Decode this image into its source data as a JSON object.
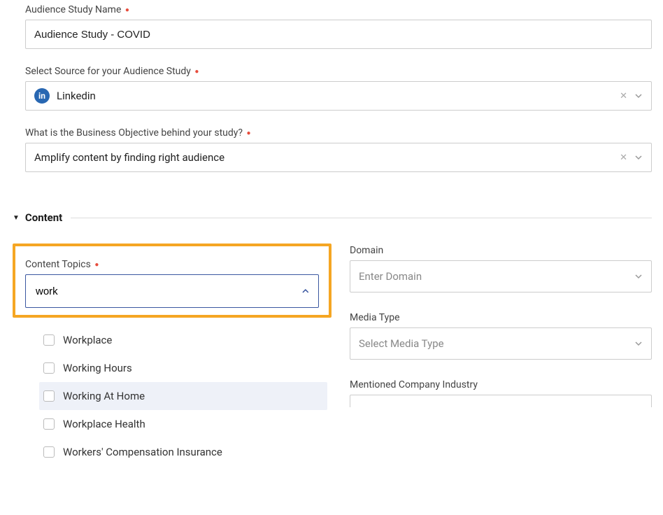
{
  "study_name": {
    "label": "Audience Study Name",
    "value": "Audience Study - COVID"
  },
  "source": {
    "label": "Select Source for your Audience Study",
    "icon_text": "in",
    "value": "Linkedin"
  },
  "objective": {
    "label": "What is the Business Objective behind your study?",
    "value": "Amplify content by finding right audience"
  },
  "content_section": {
    "title": "Content"
  },
  "content_topics": {
    "label": "Content Topics",
    "search_value": "work",
    "options": [
      {
        "label": "Workplace",
        "highlighted": false
      },
      {
        "label": "Working Hours",
        "highlighted": false
      },
      {
        "label": "Working At Home",
        "highlighted": true
      },
      {
        "label": "Workplace Health",
        "highlighted": false
      },
      {
        "label": "Workers' Compensation Insurance",
        "highlighted": false
      }
    ]
  },
  "domain": {
    "label": "Domain",
    "placeholder": "Enter Domain"
  },
  "media_type": {
    "label": "Media Type",
    "placeholder": "Select Media Type"
  },
  "mentioned_industry": {
    "label": "Mentioned Company Industry"
  }
}
